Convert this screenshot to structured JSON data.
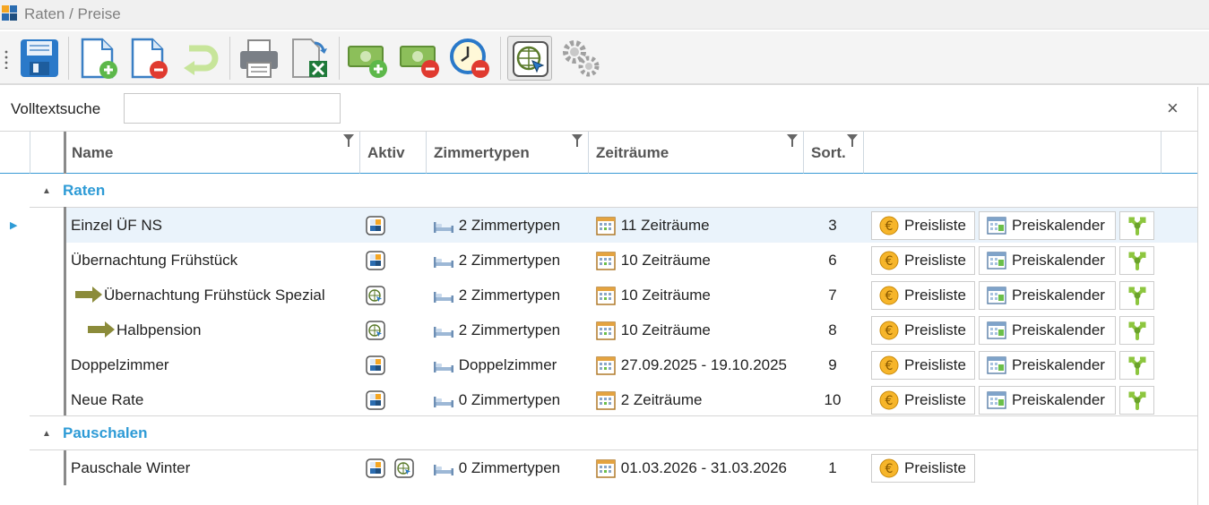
{
  "window": {
    "title": "Raten / Preise"
  },
  "toolbar": {
    "buttons": [
      {
        "icon": "save-icon",
        "tooltip": ""
      },
      {
        "icon": "new-document-icon"
      },
      {
        "icon": "delete-document-icon"
      },
      {
        "icon": "undo-icon"
      },
      {
        "icon": "print-icon"
      },
      {
        "icon": "excel-export-icon"
      },
      {
        "icon": "add-money-icon"
      },
      {
        "icon": "remove-money-icon"
      },
      {
        "icon": "remove-time-icon"
      },
      {
        "icon": "web-select-icon"
      },
      {
        "icon": "settings-gears-icon"
      }
    ]
  },
  "search": {
    "label": "Volltextsuche",
    "value": "",
    "placeholder": "",
    "close": "×"
  },
  "columns": {
    "name": "Name",
    "aktiv": "Aktiv",
    "zimmertypen": "Zimmertypen",
    "zeitraeume": "Zeiträume",
    "sort": "Sort."
  },
  "groups": [
    {
      "label": "Raten",
      "rows": [
        {
          "name": "Einzel ÜF NS",
          "level": 0,
          "aktiv": [
            "local"
          ],
          "zimmertypen": "2 Zimmertypen",
          "zeitraeume": "11 Zeiträume",
          "sort": "3",
          "preisliste": "Preisliste",
          "preiskalender": "Preiskalender",
          "fork": true,
          "selected": true
        },
        {
          "name": "Übernachtung Frühstück",
          "level": 0,
          "aktiv": [
            "local"
          ],
          "zimmertypen": "2 Zimmertypen",
          "zeitraeume": "10 Zeiträume",
          "sort": "6",
          "preisliste": "Preisliste",
          "preiskalender": "Preiskalender",
          "fork": true
        },
        {
          "name": "Übernachtung Frühstück Spezial",
          "level": 1,
          "aktiv": [
            "web"
          ],
          "zimmertypen": "2 Zimmertypen",
          "zeitraeume": "10 Zeiträume",
          "sort": "7",
          "preisliste": "Preisliste",
          "preiskalender": "Preiskalender",
          "fork": true
        },
        {
          "name": "Halbpension",
          "level": 2,
          "aktiv": [
            "web"
          ],
          "zimmertypen": "2 Zimmertypen",
          "zeitraeume": "10 Zeiträume",
          "sort": "8",
          "preisliste": "Preisliste",
          "preiskalender": "Preiskalender",
          "fork": true
        },
        {
          "name": "Doppelzimmer",
          "level": 0,
          "aktiv": [
            "local"
          ],
          "zimmertypen": "Doppelzimmer",
          "zeitraeume": "27.09.2025 - 19.10.2025",
          "sort": "9",
          "preisliste": "Preisliste",
          "preiskalender": "Preiskalender",
          "fork": true
        },
        {
          "name": "Neue Rate",
          "level": 0,
          "aktiv": [
            "local"
          ],
          "zimmertypen": "0 Zimmertypen",
          "zeitraeume": "2 Zeiträume",
          "sort": "10",
          "preisliste": "Preisliste",
          "preiskalender": "Preiskalender",
          "fork": true
        }
      ]
    },
    {
      "label": "Pauschalen",
      "rows": [
        {
          "name": "Pauschale Winter",
          "level": 0,
          "aktiv": [
            "local",
            "web"
          ],
          "zimmertypen": "0 Zimmertypen",
          "zeitraeume": "01.03.2026 - 31.03.2026",
          "sort": "1",
          "preisliste": "Preisliste",
          "preiskalender": "",
          "fork": false
        }
      ]
    }
  ],
  "colors": {
    "accent": "#2e9bd6",
    "selected_row": "#eaf3fb",
    "arrow": "#8b8b3a",
    "fork_green": "#8dc63f",
    "euro": "#f2a20c"
  }
}
